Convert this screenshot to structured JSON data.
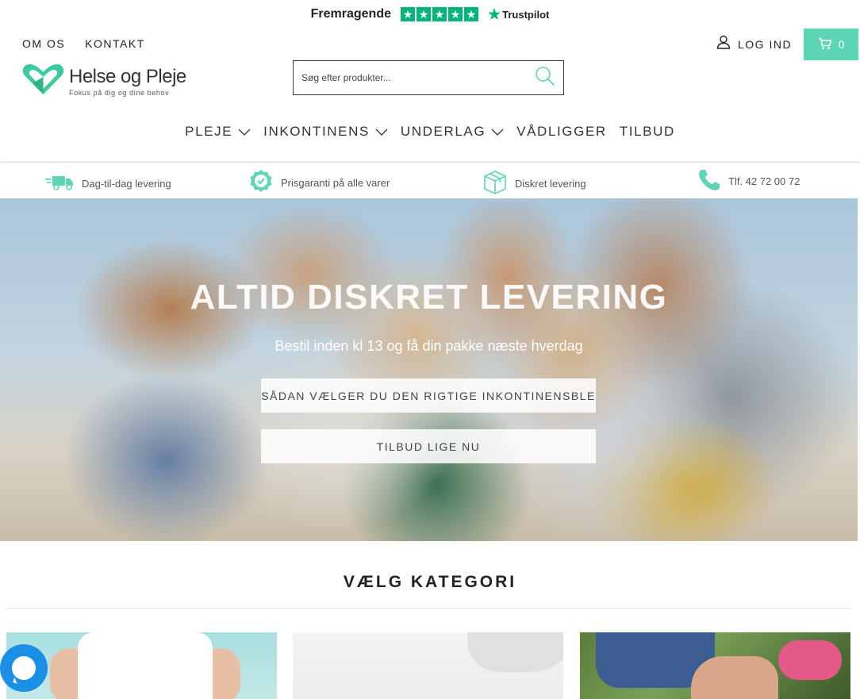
{
  "trustpilot": {
    "rating_label": "Fremragende",
    "brand": "Trustpilot",
    "star_symbol": "★"
  },
  "top_nav": {
    "links": [
      {
        "label": "OM OS"
      },
      {
        "label": "KONTAKT"
      }
    ],
    "login_label": "LOG IND",
    "cart_count": "0"
  },
  "logo": {
    "name": "Helse og Pleje",
    "tagline": "Fokus på dig og dine behov"
  },
  "search": {
    "placeholder": "Søg efter produkter..."
  },
  "main_nav": {
    "items": [
      {
        "label": "PLEJE",
        "has_dropdown": true
      },
      {
        "label": "INKONTINENS",
        "has_dropdown": true
      },
      {
        "label": "UNDERLAG",
        "has_dropdown": true
      },
      {
        "label": "VÅDLIGGER",
        "has_dropdown": false
      },
      {
        "label": "TILBUD",
        "has_dropdown": false
      }
    ]
  },
  "usp": [
    {
      "label": "Dag-til-dag levering",
      "icon": "truck-icon"
    },
    {
      "label": "Prisgaranti på alle varer",
      "icon": "check-badge-icon"
    },
    {
      "label": "Diskret levering",
      "icon": "box-icon"
    },
    {
      "label": "Tlf. 42 72 00 72",
      "icon": "phone-icon"
    }
  ],
  "hero": {
    "title": "ALTID DISKRET LEVERING",
    "subtitle": "Bestil inden kl 13 og få din pakke næste hverdag",
    "button_primary": "SÅDAN VÆLGER DU DEN RIGTIGE INKONTINENSBLE",
    "button_secondary": "TILBUD LIGE NU"
  },
  "categories": {
    "title": "VÆLG KATEGORI"
  },
  "colors": {
    "accent": "#5cd6b4",
    "trustpilot_green": "#00b67a",
    "chat_blue": "#1b8fe6",
    "text_dark": "#222222"
  }
}
